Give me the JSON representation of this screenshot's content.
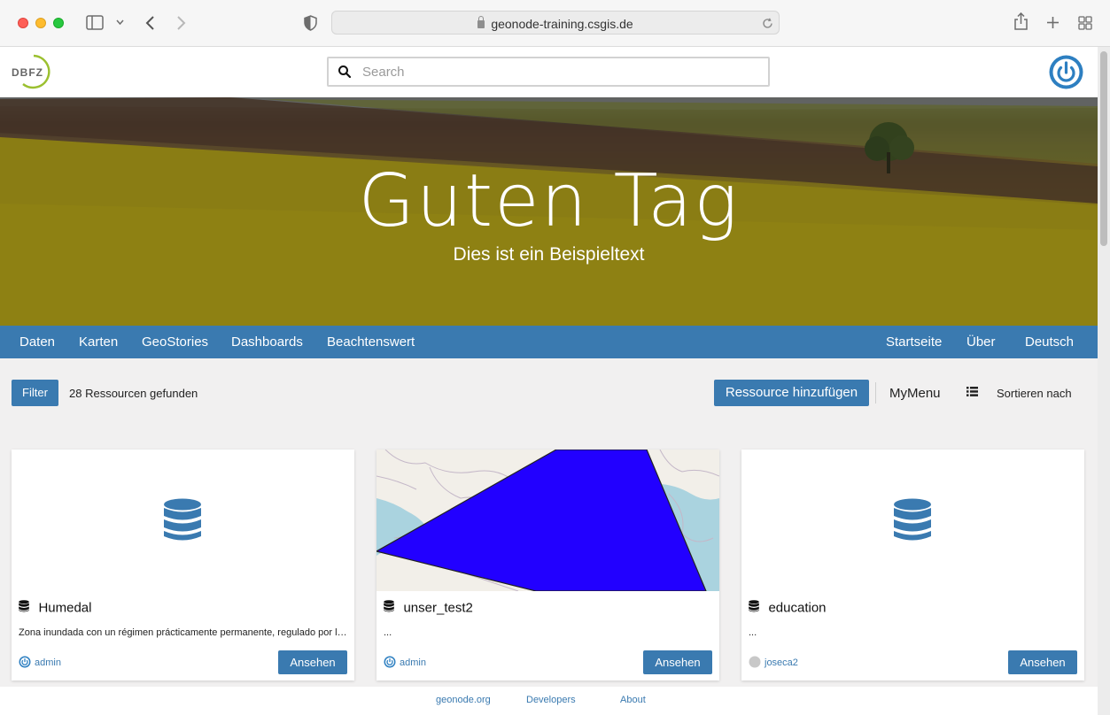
{
  "browser": {
    "url": "geonode-training.csgis.de"
  },
  "header": {
    "logo_text": "DBFZ",
    "search_placeholder": "Search"
  },
  "hero": {
    "title": "Guten Tag",
    "subtitle": "Dies ist ein Beispieltext"
  },
  "nav": {
    "left": [
      "Daten",
      "Karten",
      "GeoStories",
      "Dashboards",
      "Beachtenswert"
    ],
    "right": [
      "Startseite",
      "Über",
      "Deutsch"
    ]
  },
  "toolbar": {
    "filter_label": "Filter",
    "count_text": "28 Ressourcen gefunden",
    "add_label": "Ressource hinzufügen",
    "mymenu_label": "MyMenu",
    "sort_label": "Sortieren nach"
  },
  "cards": [
    {
      "title": "Humedal",
      "description": "Zona inundada con un régimen prácticamente permanente, regulado por las precipitaciones y el ascenso freático",
      "owner": "admin",
      "view_label": "Ansehen",
      "thumbnail": "database-icon"
    },
    {
      "title": "unser_test2",
      "description": "...",
      "owner": "admin",
      "view_label": "Ansehen",
      "thumbnail": "map-thumbnail"
    },
    {
      "title": "education",
      "description": "...",
      "owner": "joseca2",
      "view_label": "Ansehen",
      "thumbnail": "database-icon"
    }
  ],
  "footer": {
    "links": [
      "geonode.org",
      "Developers",
      "About"
    ]
  },
  "colors": {
    "primary": "#3a7ab0",
    "polygon": "#2200ff"
  }
}
